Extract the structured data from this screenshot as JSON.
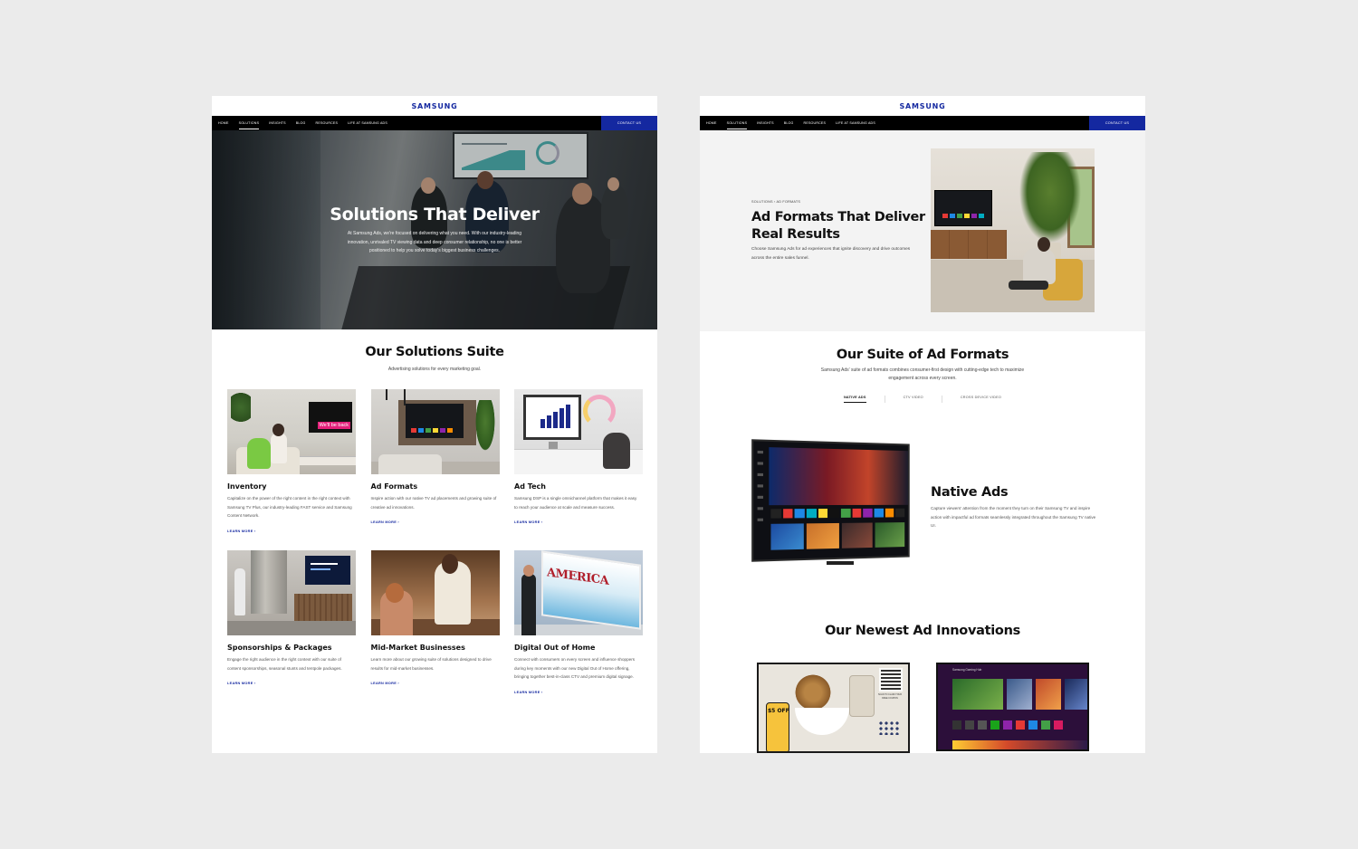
{
  "brand": {
    "logo": "SAMSUNG",
    "color": "#1428a0"
  },
  "nav": {
    "items": [
      "HOME",
      "SOLUTIONS",
      "INSIGHTS",
      "BLOG",
      "RESOURCES",
      "LIFE AT SAMSUNG ADS"
    ],
    "active": "SOLUTIONS",
    "contact": "CONTACT US"
  },
  "left": {
    "hero": {
      "title": "Solutions That Deliver",
      "subtitle": "At Samsung Ads, we're focused on delivering what you need. With our industry-leading innovation, unrivaled TV viewing data and deep consumer relationship, no one is better positioned to help you solve today's biggest business challenges."
    },
    "suite": {
      "title": "Our Solutions Suite",
      "subtitle": "Advertising solutions for every marketing goal."
    },
    "cards": [
      {
        "title": "Inventory",
        "desc": "Capitalize on the power of the right content in the right context with Samsung TV Plus, our industry-leading FAST service and Samsung Content Network.",
        "cta": "LEARN MORE ›",
        "image_text": "We'll be back"
      },
      {
        "title": "Ad Formats",
        "desc": "Inspire action with our native TV ad placements and growing suite of creative ad innovations.",
        "cta": "LEARN MORE ›"
      },
      {
        "title": "Ad Tech",
        "desc": "Samsung DSP is a single omnichannel platform that makes it easy to reach your audience at scale and measure success.",
        "cta": "LEARN MORE ›"
      },
      {
        "title": "Sponsorships & Packages",
        "desc": "Engage the right audience in the right context with our suite of content sponsorships, seasonal stunts and tentpole packages.",
        "cta": "LEARN MORE ›"
      },
      {
        "title": "Mid-Market Businesses",
        "desc": "Learn more about our growing suite of solutions designed to drive results for mid-market businesses.",
        "cta": "LEARN MORE ›"
      },
      {
        "title": "Digital Out of Home",
        "desc": "Connect with consumers on every screen and influence shoppers during key moments with our new Digital Out of Home offering, bringing together best-in-class CTV and premium digital signage.",
        "cta": "LEARN MORE ›",
        "image_text": "AMERICA"
      }
    ]
  },
  "right": {
    "hero": {
      "breadcrumb": "SOLUTIONS  ›  AD FORMATS",
      "title": "Ad Formats That Deliver Real Results",
      "subtitle": "Choose Samsung Ads for ad experiences that ignite discovery and drive outcomes across the entire sales funnel."
    },
    "suite": {
      "title": "Our Suite of Ad Formats",
      "subtitle": "Samsung Ads' suite of ad formats combines consumer-first design with cutting-edge tech to maximize engagement across every screen."
    },
    "tabs": [
      "NATIVE ADS",
      "CTV VIDEO",
      "CROSS DEVICE VIDEO"
    ],
    "active_tab": "NATIVE ADS",
    "native": {
      "title": "Native Ads",
      "desc": "Capture viewers' attention from the moment they turn on their Samsung TV and inspire action with impactful ad formats seamlessly integrated throughout the Samsung TV native UI."
    },
    "innovations": {
      "title": "Our Newest Ad Innovations",
      "promo_label": "$5 OFF",
      "qr_label": "SCAN TO CLAIM YOUR FREE COUPON",
      "gaming_header": "Samsung Gaming Hub"
    }
  }
}
